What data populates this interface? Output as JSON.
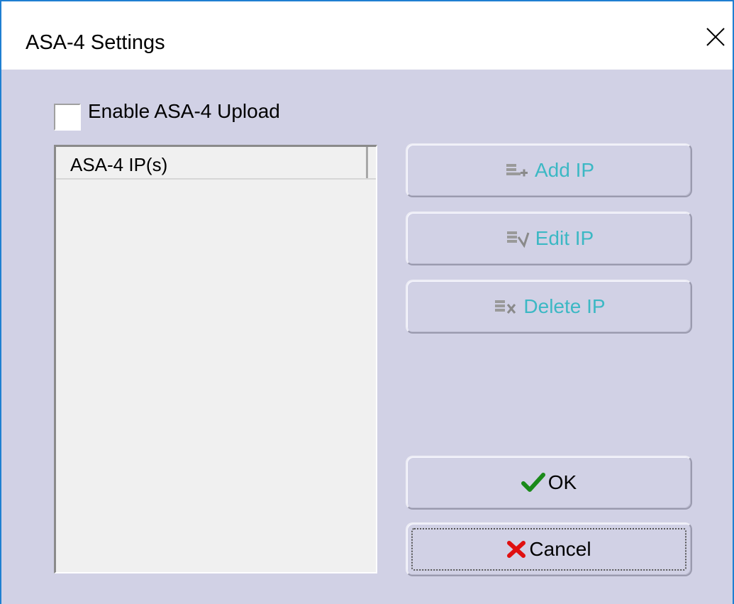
{
  "window": {
    "title": "ASA-4 Settings",
    "close_icon": "close-icon"
  },
  "upload": {
    "checkbox_label": "Enable ASA-4 Upload",
    "checked": false
  },
  "listview": {
    "columns": [
      "ASA-4 IP(s)"
    ],
    "rows": []
  },
  "buttons": {
    "add_ip": {
      "label": "Add IP",
      "icon": "add-ip-icon",
      "enabled": false
    },
    "edit_ip": {
      "label": "Edit IP",
      "icon": "edit-ip-icon",
      "enabled": false
    },
    "delete_ip": {
      "label": "Delete IP",
      "icon": "delete-ip-icon",
      "enabled": false
    },
    "ok": {
      "label": "OK",
      "icon": "checkmark-icon",
      "enabled": true
    },
    "cancel": {
      "label": "Cancel",
      "icon": "x-icon",
      "enabled": true
    }
  },
  "colors": {
    "dialog_bg": "#d1d1e5",
    "disabled_text": "#3cb8c4",
    "ok_green": "#1a8a1a",
    "cancel_red": "#e01010",
    "title_border": "#1f7fd1"
  }
}
